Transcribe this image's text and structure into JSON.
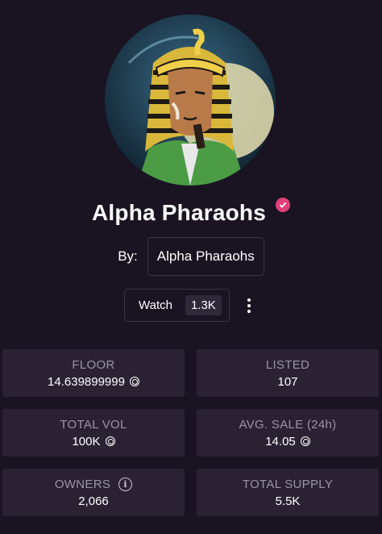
{
  "collection": {
    "name": "Alpha Pharaohs",
    "verified_icon": "verified-badge-icon",
    "accent_color": "#e0417a",
    "by_label": "By:",
    "creator": "Alpha Pharaohs"
  },
  "watch": {
    "label": "Watch",
    "count": "1.3K",
    "more_icon": "more-vertical-icon"
  },
  "stats": {
    "floor": {
      "label": "FLOOR",
      "value": "14.639899999"
    },
    "listed": {
      "label": "LISTED",
      "value": "107"
    },
    "total_vol": {
      "label": "TOTAL VOL",
      "value": "100K"
    },
    "avg_sale": {
      "label": "AVG. SALE (24h)",
      "value": "14.05"
    },
    "owners": {
      "label": "OWNERS",
      "value": "2,066",
      "info_icon": "info-icon"
    },
    "total_supply": {
      "label": "TOTAL SUPPLY",
      "value": "5.5K"
    }
  },
  "currency_icon": "sol-coin-icon"
}
